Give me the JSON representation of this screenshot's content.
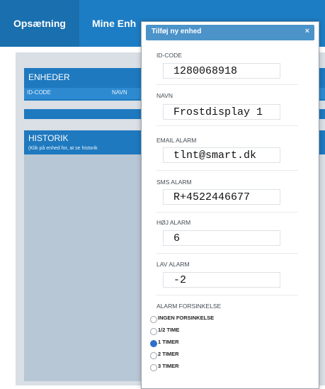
{
  "nav": {
    "tabs": [
      {
        "label": "Opsætning",
        "active": true
      },
      {
        "label": "Mine Enh",
        "active": false
      }
    ]
  },
  "main": {
    "enheder": {
      "title": "ENHEDER",
      "col_id": "ID-CODE",
      "col_name": "NAVN"
    },
    "historik": {
      "title": "HISTORIK",
      "hint": "(Klik på enhed for, at se historik"
    }
  },
  "modal": {
    "title": "Tilføj ny enhed",
    "close_icon": "×",
    "fields": [
      {
        "label": "ID-CODE",
        "value": "1280068918"
      },
      {
        "label": "NAVN",
        "value": "Frostdisplay 1"
      },
      {
        "label": "EMAIL ALARM",
        "value": "tlnt@smart.dk"
      },
      {
        "label": "SMS ALARM",
        "value": "R+4522446677"
      },
      {
        "label": "HØJ ALARM",
        "value": "6"
      },
      {
        "label": "LAV ALARM",
        "value": "-2"
      }
    ],
    "delay": {
      "label": "ALARM FORSINKELSE",
      "options": [
        {
          "label": "INGEN FORSINKELSE",
          "checked": false
        },
        {
          "label": "1/2 TIME",
          "checked": false
        },
        {
          "label": "1 TIMER",
          "checked": true
        },
        {
          "label": "2 TIMER",
          "checked": false
        },
        {
          "label": "3 TIMER",
          "checked": false
        }
      ]
    }
  },
  "colors": {
    "nav": "#1d7dc4",
    "panel": "#1e79bf",
    "modal_header": "#4b93c9"
  }
}
